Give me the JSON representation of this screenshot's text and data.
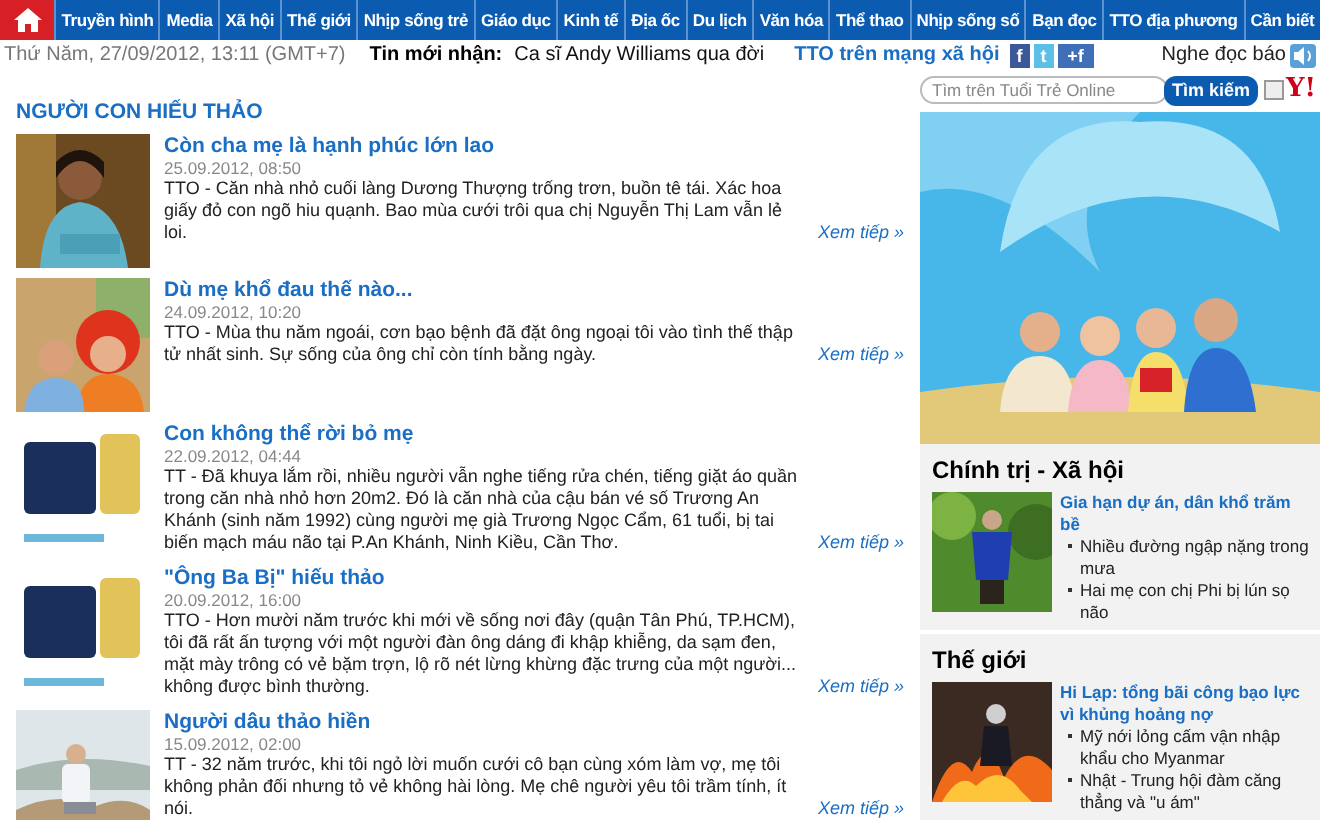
{
  "nav": {
    "home_selected": true,
    "items": [
      {
        "label": "Truyền hình"
      },
      {
        "label": "Media"
      },
      {
        "label": "Xã hội"
      },
      {
        "label": "Thế giới"
      },
      {
        "label": "Nhịp sống trẻ"
      },
      {
        "label": "Giáo dục"
      },
      {
        "label": "Kinh tế"
      },
      {
        "label": "Địa ốc"
      },
      {
        "label": "Du lịch"
      },
      {
        "label": "Văn hóa"
      },
      {
        "label": "Thể thao"
      },
      {
        "label": "Nhịp sống số"
      },
      {
        "label": "Bạn đọc"
      },
      {
        "label": "TTO địa phương"
      },
      {
        "label": "Cần biết"
      }
    ]
  },
  "infobar": {
    "datetime": "Thứ Năm, 27/09/2012, 13:11 (GMT+7)",
    "latest_label": "Tin mới nhận:",
    "latest": "Ca sĩ Andy Williams qua đời",
    "social_label": "TTO trên mạng xã hội",
    "social": [
      "f",
      "t",
      "+f"
    ],
    "listen": "Nghe đọc báo"
  },
  "section_title": "NGƯỜI CON HIẾU THẢO",
  "articles": [
    {
      "title": "Còn cha mẹ là hạnh phúc lớn lao",
      "date": "25.09.2012, 08:50",
      "summary": "TTO - Căn nhà nhỏ cuối làng Dương Thượng trống trơn, buồn tê tái. Xác hoa giấy đỏ con ngõ hiu quạnh. Bao mùa cưới trôi qua chị Nguyễn Thị Lam vẫn lẻ loi.",
      "more": "Xem tiếp »"
    },
    {
      "title": "Dù mẹ khổ đau thế nào...",
      "date": "24.09.2012, 10:20",
      "summary": "TTO - Mùa thu năm ngoái, cơn bạo bệnh đã đặt ông ngoại tôi vào tình thế thập tử nhất sinh. Sự sống của ông chỉ còn tính bằng ngày.",
      "more": "Xem tiếp »"
    },
    {
      "title": "Con không thể rời bỏ mẹ",
      "date": "22.09.2012, 04:44",
      "summary": "TT - Đã khuya lắm rồi, nhiều người vẫn nghe tiếng rửa chén, tiếng giặt áo quần trong căn nhà nhỏ hơn 20m2. Đó là căn nhà của cậu bán vé số Trương An Khánh (sinh năm 1992) cùng người mẹ già Trương Ngọc Cẩm, 61 tuổi, bị tai biến mạch máu não tại P.An Khánh, Ninh Kiều, Cần Thơ.",
      "more": "Xem tiếp »"
    },
    {
      "title": "\"Ông Ba Bị\" hiếu thảo",
      "date": "20.09.2012, 16:00",
      "summary": "TTO - Hơn mười năm trước khi mới về sống nơi đây (quận Tân Phú, TP.HCM), tôi đã rất ấn tượng với một người đàn ông dáng đi khập khiễng, da sạm đen, mặt mày trông có vẻ bặm trợn, lộ rõ nét lừng khừng đặc trưng của một người... không được bình thường.",
      "more": "Xem tiếp »"
    },
    {
      "title": "Người dâu thảo hiền",
      "date": "15.09.2012, 02:00",
      "summary": "TT - 32 năm trước, khi tôi ngỏ lời muốn cưới cô bạn cùng xóm làm vợ, mẹ tôi không phản đối nhưng tỏ vẻ không hài lòng. Mẹ chê người yêu tôi trầm tính, ít nói.",
      "more": "Xem tiếp »"
    }
  ],
  "search": {
    "placeholder": "Tìm trên Tuổi Trẻ Online",
    "button": "Tìm kiếm",
    "checked": false,
    "engine_logo": "Y!"
  },
  "sidebar_sections": [
    {
      "title": "Chính trị - Xã hội",
      "lead": "Gia hạn dự án, dân khổ trăm bề",
      "bullets": [
        "Nhiều đường ngập nặng trong mưa",
        "Hai mẹ con chị Phi bị lún sọ não"
      ]
    },
    {
      "title": "Thế giới",
      "lead": "Hi Lạp: tổng bãi công bạo lực vì khủng hoảng nợ",
      "bullets": [
        "Mỹ nới lỏng cấm vận nhập khẩu cho Myanmar",
        "Nhật - Trung hội đàm căng thẳng và \"u ám\""
      ]
    }
  ]
}
